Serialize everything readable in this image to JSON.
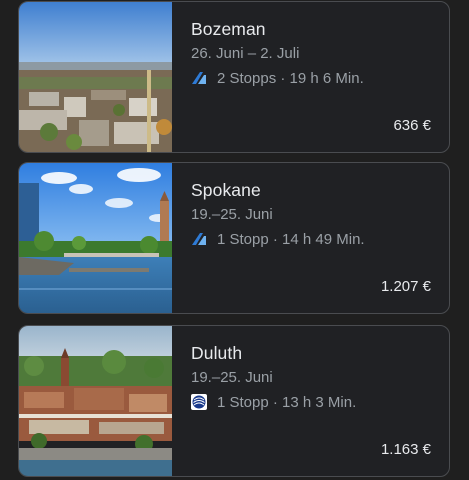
{
  "results": [
    {
      "city": "Bozeman",
      "dates": "26. Juni – 2. Juli",
      "airline_icon": "alaska-airlines-icon",
      "stops_info": "2 Stopps · 19 h 6 Min.",
      "price": "636 €"
    },
    {
      "city": "Spokane",
      "dates": "19.–25. Juni",
      "airline_icon": "alaska-airlines-icon",
      "stops_info": "1 Stopp · 14 h 49 Min.",
      "price": "1.207 €"
    },
    {
      "city": "Duluth",
      "dates": "19.–25. Juni",
      "airline_icon": "united-airlines-icon",
      "stops_info": "1 Stopp · 13 h 3 Min.",
      "price": "1.163 €"
    }
  ],
  "colors": {
    "background": "#1f1f1f",
    "card_border": "#4a4c50",
    "primary_text": "#e8eaed",
    "secondary_text": "#9aa0a6",
    "alaska_blue": "#2e7bd6",
    "united_blue": "#1a3a8c"
  }
}
